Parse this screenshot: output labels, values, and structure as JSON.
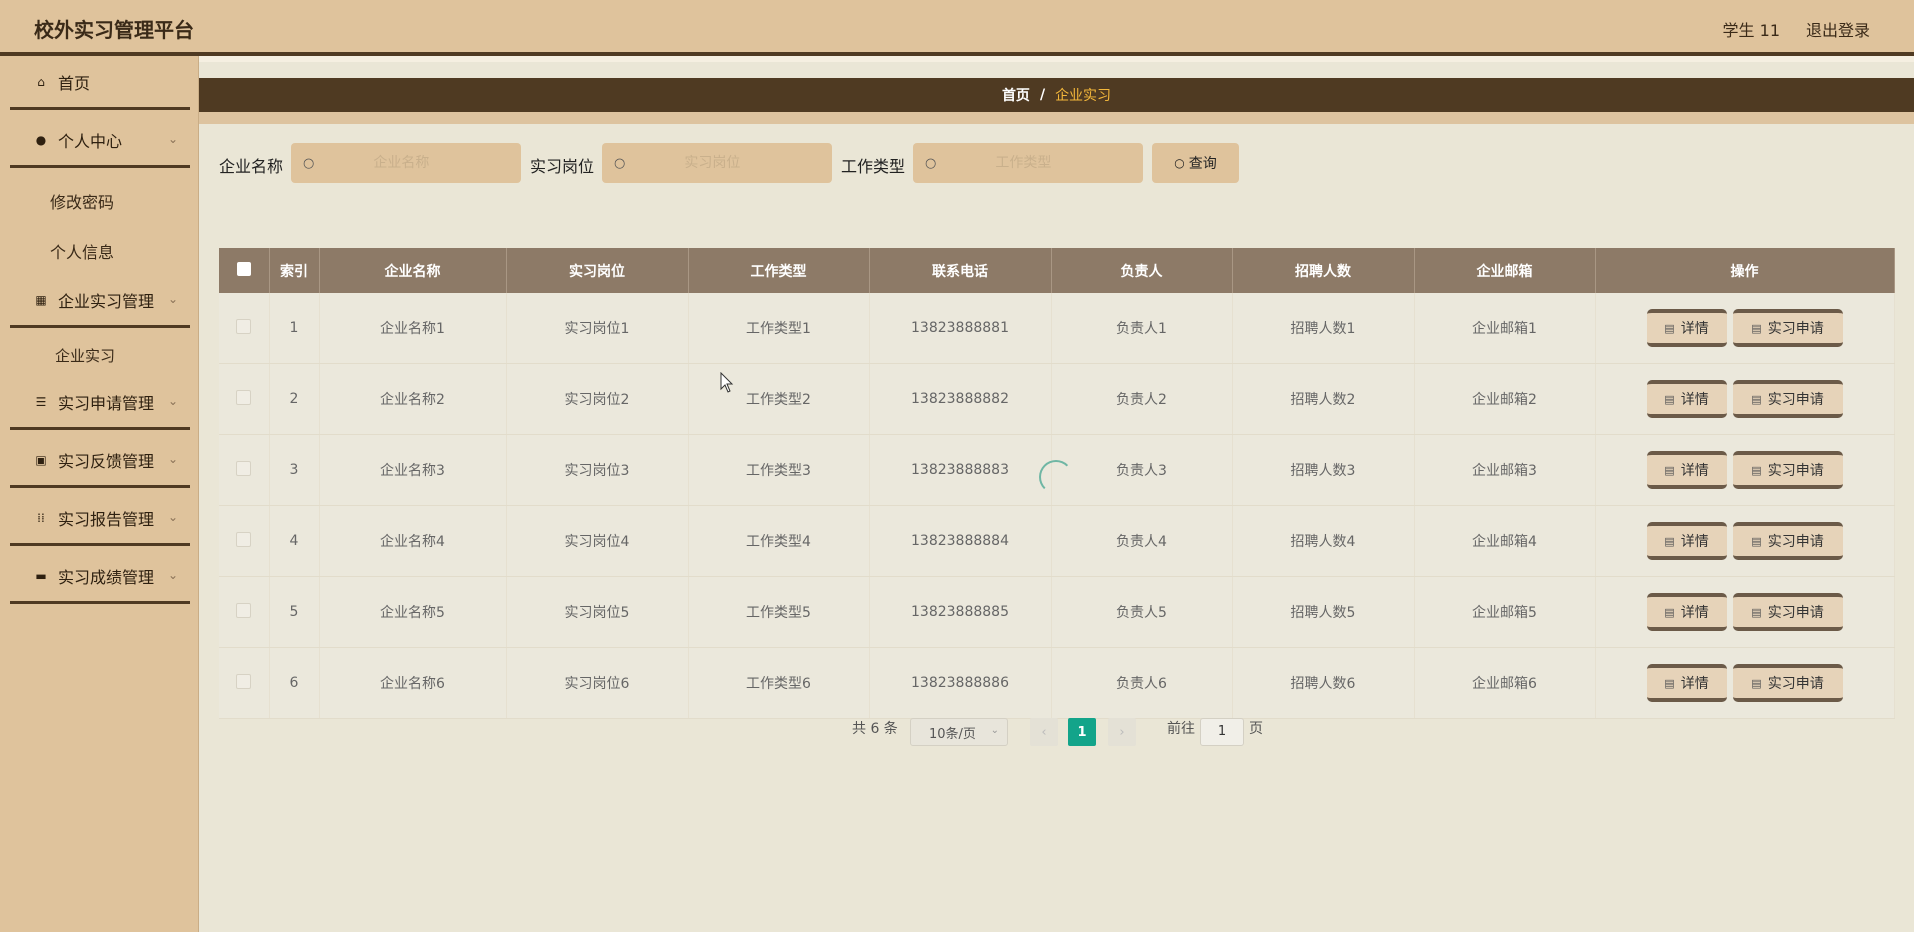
{
  "header": {
    "title": "校外实习管理平台",
    "user": "学生 11",
    "logout": "退出登录"
  },
  "sidebar": {
    "home": "首页",
    "personal": "个人中心",
    "change_password": "修改密码",
    "personal_info": "个人信息",
    "enterprise_mgmt": "企业实习管理",
    "enterprise_internship": "企业实习",
    "apply_mgmt": "实习申请管理",
    "feedback_mgmt": "实习反馈管理",
    "report_mgmt": "实习报告管理",
    "score_mgmt": "实习成绩管理"
  },
  "breadcrumb": {
    "home": "首页",
    "sep": "/",
    "current": "企业实习"
  },
  "search": {
    "company_label": "企业名称",
    "company_placeholder": "企业名称",
    "position_label": "实习岗位",
    "position_placeholder": "实习岗位",
    "type_label": "工作类型",
    "type_placeholder": "工作类型",
    "query_button": "查询"
  },
  "table": {
    "headers": [
      "索引",
      "企业名称",
      "实习岗位",
      "工作类型",
      "联系电话",
      "负责人",
      "招聘人数",
      "企业邮箱",
      "操作"
    ],
    "detail_label": "详情",
    "apply_label": "实习申请",
    "rows": [
      {
        "index": "1",
        "company": "企业名称1",
        "position": "实习岗位1",
        "type": "工作类型1",
        "phone": "13823888881",
        "manager": "负责人1",
        "count": "招聘人数1",
        "email": "企业邮箱1"
      },
      {
        "index": "2",
        "company": "企业名称2",
        "position": "实习岗位2",
        "type": "工作类型2",
        "phone": "13823888882",
        "manager": "负责人2",
        "count": "招聘人数2",
        "email": "企业邮箱2"
      },
      {
        "index": "3",
        "company": "企业名称3",
        "position": "实习岗位3",
        "type": "工作类型3",
        "phone": "13823888883",
        "manager": "负责人3",
        "count": "招聘人数3",
        "email": "企业邮箱3"
      },
      {
        "index": "4",
        "company": "企业名称4",
        "position": "实习岗位4",
        "type": "工作类型4",
        "phone": "13823888884",
        "manager": "负责人4",
        "count": "招聘人数4",
        "email": "企业邮箱4"
      },
      {
        "index": "5",
        "company": "企业名称5",
        "position": "实习岗位5",
        "type": "工作类型5",
        "phone": "13823888885",
        "manager": "负责人5",
        "count": "招聘人数5",
        "email": "企业邮箱5"
      },
      {
        "index": "6",
        "company": "企业名称6",
        "position": "实习岗位6",
        "type": "工作类型6",
        "phone": "13823888886",
        "manager": "负责人6",
        "count": "招聘人数6",
        "email": "企业邮箱6"
      }
    ]
  },
  "pagination": {
    "total": "共 6 条",
    "page_size": "10条/页",
    "prev": "‹",
    "current_page": "1",
    "next": "›",
    "goto_label": "前往",
    "goto_value": "1",
    "page_suffix": "页"
  },
  "colors": {
    "header_bg": "#dfc39c",
    "accent_dark": "#4f3a22",
    "table_header": "#8d7a67",
    "active_page": "#13a48a",
    "breadcrumb_current": "#f4b83b"
  }
}
